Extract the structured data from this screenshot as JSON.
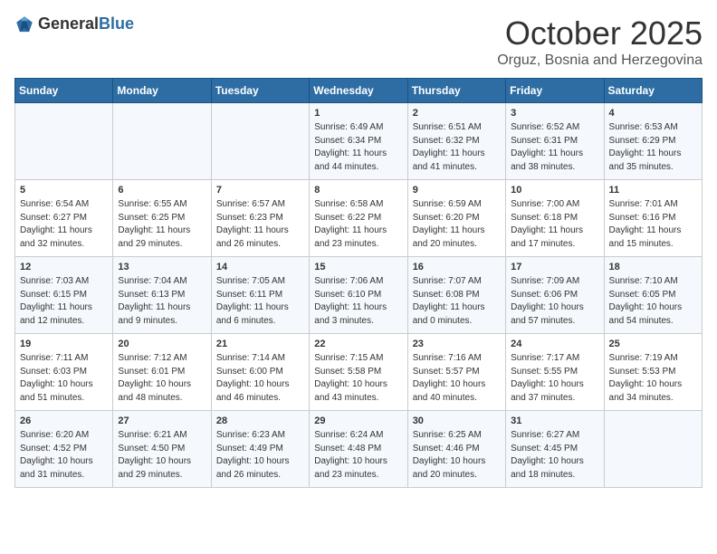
{
  "logo": {
    "general": "General",
    "blue": "Blue"
  },
  "title": "October 2025",
  "subtitle": "Orguz, Bosnia and Herzegovina",
  "days_of_week": [
    "Sunday",
    "Monday",
    "Tuesday",
    "Wednesday",
    "Thursday",
    "Friday",
    "Saturday"
  ],
  "weeks": [
    [
      {
        "day": "",
        "content": ""
      },
      {
        "day": "",
        "content": ""
      },
      {
        "day": "",
        "content": ""
      },
      {
        "day": "1",
        "content": "Sunrise: 6:49 AM\nSunset: 6:34 PM\nDaylight: 11 hours\nand 44 minutes."
      },
      {
        "day": "2",
        "content": "Sunrise: 6:51 AM\nSunset: 6:32 PM\nDaylight: 11 hours\nand 41 minutes."
      },
      {
        "day": "3",
        "content": "Sunrise: 6:52 AM\nSunset: 6:31 PM\nDaylight: 11 hours\nand 38 minutes."
      },
      {
        "day": "4",
        "content": "Sunrise: 6:53 AM\nSunset: 6:29 PM\nDaylight: 11 hours\nand 35 minutes."
      }
    ],
    [
      {
        "day": "5",
        "content": "Sunrise: 6:54 AM\nSunset: 6:27 PM\nDaylight: 11 hours\nand 32 minutes."
      },
      {
        "day": "6",
        "content": "Sunrise: 6:55 AM\nSunset: 6:25 PM\nDaylight: 11 hours\nand 29 minutes."
      },
      {
        "day": "7",
        "content": "Sunrise: 6:57 AM\nSunset: 6:23 PM\nDaylight: 11 hours\nand 26 minutes."
      },
      {
        "day": "8",
        "content": "Sunrise: 6:58 AM\nSunset: 6:22 PM\nDaylight: 11 hours\nand 23 minutes."
      },
      {
        "day": "9",
        "content": "Sunrise: 6:59 AM\nSunset: 6:20 PM\nDaylight: 11 hours\nand 20 minutes."
      },
      {
        "day": "10",
        "content": "Sunrise: 7:00 AM\nSunset: 6:18 PM\nDaylight: 11 hours\nand 17 minutes."
      },
      {
        "day": "11",
        "content": "Sunrise: 7:01 AM\nSunset: 6:16 PM\nDaylight: 11 hours\nand 15 minutes."
      }
    ],
    [
      {
        "day": "12",
        "content": "Sunrise: 7:03 AM\nSunset: 6:15 PM\nDaylight: 11 hours\nand 12 minutes."
      },
      {
        "day": "13",
        "content": "Sunrise: 7:04 AM\nSunset: 6:13 PM\nDaylight: 11 hours\nand 9 minutes."
      },
      {
        "day": "14",
        "content": "Sunrise: 7:05 AM\nSunset: 6:11 PM\nDaylight: 11 hours\nand 6 minutes."
      },
      {
        "day": "15",
        "content": "Sunrise: 7:06 AM\nSunset: 6:10 PM\nDaylight: 11 hours\nand 3 minutes."
      },
      {
        "day": "16",
        "content": "Sunrise: 7:07 AM\nSunset: 6:08 PM\nDaylight: 11 hours\nand 0 minutes."
      },
      {
        "day": "17",
        "content": "Sunrise: 7:09 AM\nSunset: 6:06 PM\nDaylight: 10 hours\nand 57 minutes."
      },
      {
        "day": "18",
        "content": "Sunrise: 7:10 AM\nSunset: 6:05 PM\nDaylight: 10 hours\nand 54 minutes."
      }
    ],
    [
      {
        "day": "19",
        "content": "Sunrise: 7:11 AM\nSunset: 6:03 PM\nDaylight: 10 hours\nand 51 minutes."
      },
      {
        "day": "20",
        "content": "Sunrise: 7:12 AM\nSunset: 6:01 PM\nDaylight: 10 hours\nand 48 minutes."
      },
      {
        "day": "21",
        "content": "Sunrise: 7:14 AM\nSunset: 6:00 PM\nDaylight: 10 hours\nand 46 minutes."
      },
      {
        "day": "22",
        "content": "Sunrise: 7:15 AM\nSunset: 5:58 PM\nDaylight: 10 hours\nand 43 minutes."
      },
      {
        "day": "23",
        "content": "Sunrise: 7:16 AM\nSunset: 5:57 PM\nDaylight: 10 hours\nand 40 minutes."
      },
      {
        "day": "24",
        "content": "Sunrise: 7:17 AM\nSunset: 5:55 PM\nDaylight: 10 hours\nand 37 minutes."
      },
      {
        "day": "25",
        "content": "Sunrise: 7:19 AM\nSunset: 5:53 PM\nDaylight: 10 hours\nand 34 minutes."
      }
    ],
    [
      {
        "day": "26",
        "content": "Sunrise: 6:20 AM\nSunset: 4:52 PM\nDaylight: 10 hours\nand 31 minutes."
      },
      {
        "day": "27",
        "content": "Sunrise: 6:21 AM\nSunset: 4:50 PM\nDaylight: 10 hours\nand 29 minutes."
      },
      {
        "day": "28",
        "content": "Sunrise: 6:23 AM\nSunset: 4:49 PM\nDaylight: 10 hours\nand 26 minutes."
      },
      {
        "day": "29",
        "content": "Sunrise: 6:24 AM\nSunset: 4:48 PM\nDaylight: 10 hours\nand 23 minutes."
      },
      {
        "day": "30",
        "content": "Sunrise: 6:25 AM\nSunset: 4:46 PM\nDaylight: 10 hours\nand 20 minutes."
      },
      {
        "day": "31",
        "content": "Sunrise: 6:27 AM\nSunset: 4:45 PM\nDaylight: 10 hours\nand 18 minutes."
      },
      {
        "day": "",
        "content": ""
      }
    ]
  ]
}
